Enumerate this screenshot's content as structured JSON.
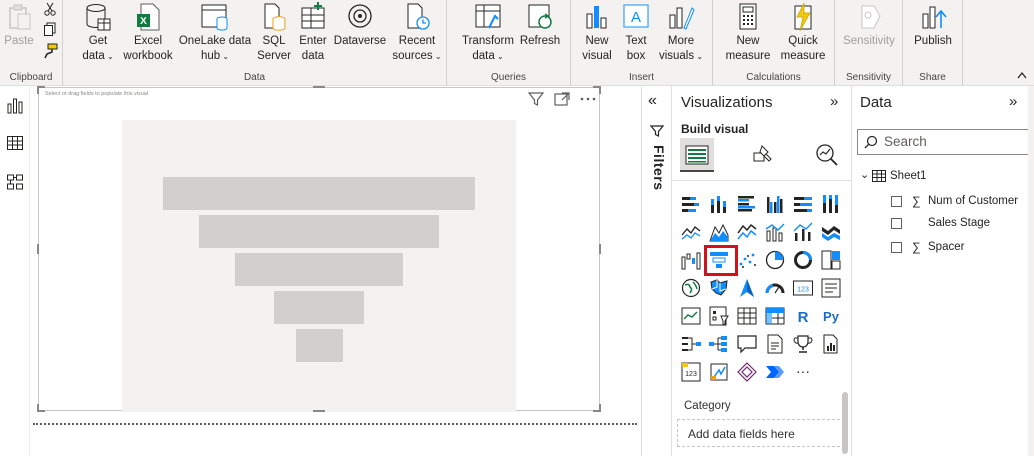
{
  "ribbon": {
    "groups": [
      {
        "label": "Clipboard"
      },
      {
        "label": "Data"
      },
      {
        "label": "Queries"
      },
      {
        "label": "Insert"
      },
      {
        "label": "Calculations"
      },
      {
        "label": "Sensitivity"
      },
      {
        "label": "Share"
      }
    ],
    "buttons": {
      "paste": "Paste",
      "get_data": "Get\ndata",
      "excel": "Excel\nworkbook",
      "onelake": "OneLake data\nhub",
      "sql": "SQL\nServer",
      "enter": "Enter\ndata",
      "dataverse": "Dataverse",
      "recent": "Recent\nsources",
      "transform": "Transform\ndata",
      "refresh": "Refresh",
      "new_visual": "New\nvisual",
      "text_box": "Text\nbox",
      "more_visuals": "More\nvisuals",
      "new_measure": "New\nmeasure",
      "quick_measure": "Quick\nmeasure",
      "sensitivity": "Sensitivity",
      "publish": "Publish"
    },
    "chevron": "⌄"
  },
  "canvas": {
    "hint": "Select or drag fields to populate this visual",
    "funnel_placeholder_levels": [
      1.0,
      0.77,
      0.54,
      0.29,
      0.15
    ]
  },
  "filters": {
    "label": "Filters",
    "expand_glyph": "«"
  },
  "visualizations": {
    "title": "Visualizations",
    "collapse_glyph": "»",
    "build_visual": "Build visual",
    "selected_visual": "funnel",
    "more_glyph": "···",
    "category_label": "Category",
    "drop_placeholder": "Add data fields here"
  },
  "data": {
    "title": "Data",
    "collapse_glyph": "»",
    "search_placeholder": "Search",
    "table": "Sheet1",
    "fields": [
      {
        "name": "Num of Customer",
        "sigma": "∑"
      },
      {
        "name": "Sales Stage",
        "sigma": ""
      },
      {
        "name": "Spacer",
        "sigma": "∑"
      }
    ],
    "expand_glyph": "⌄"
  },
  "colors": {
    "accent": "#f2c811",
    "selection": "#d0131b",
    "icon_blue": "#118dff",
    "funnel_gray": "#d2d0ce"
  }
}
